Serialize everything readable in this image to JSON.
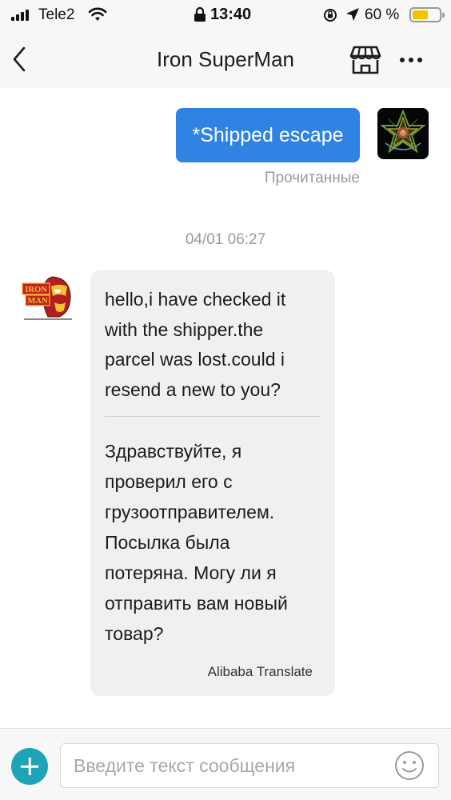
{
  "status_bar": {
    "carrier": "Tele2",
    "time": "13:40",
    "battery_text": "60 %",
    "battery_level": 0.6,
    "icons": [
      "signal-icon",
      "wifi-icon",
      "lock-icon",
      "rotation-lock-icon",
      "location-icon",
      "battery-icon"
    ]
  },
  "nav": {
    "title": "Iron SuperMan",
    "icons": [
      "back-icon",
      "store-icon",
      "more-icon"
    ]
  },
  "messages": {
    "outgoing": {
      "text": "*Shipped escape",
      "status": "Прочитанные"
    },
    "timestamp": "04/01 06:27",
    "incoming": {
      "text": "hello,i have checked it\nwith the shipper.the\nparcel was lost.could i\nresend a new to you?",
      "translation": "Здравствуйте, я\nпроверил его с\nгрузоотправителем.\nПосылка была\nпотеряна. Могу ли я\nотправить вам новый\nтовар?",
      "translator": "Alibaba Translate"
    },
    "seller_logo_text": [
      "IRON",
      "MAN"
    ]
  },
  "input_bar": {
    "placeholder": "Введите текст сообщения",
    "value": "",
    "icons": [
      "add-icon",
      "emoji-icon"
    ]
  },
  "colors": {
    "outgoing_bubble": "#2f83e3",
    "incoming_bubble": "#f0f0f0",
    "add_button": "#1fa3b6",
    "battery_fill": "#f2c400"
  }
}
